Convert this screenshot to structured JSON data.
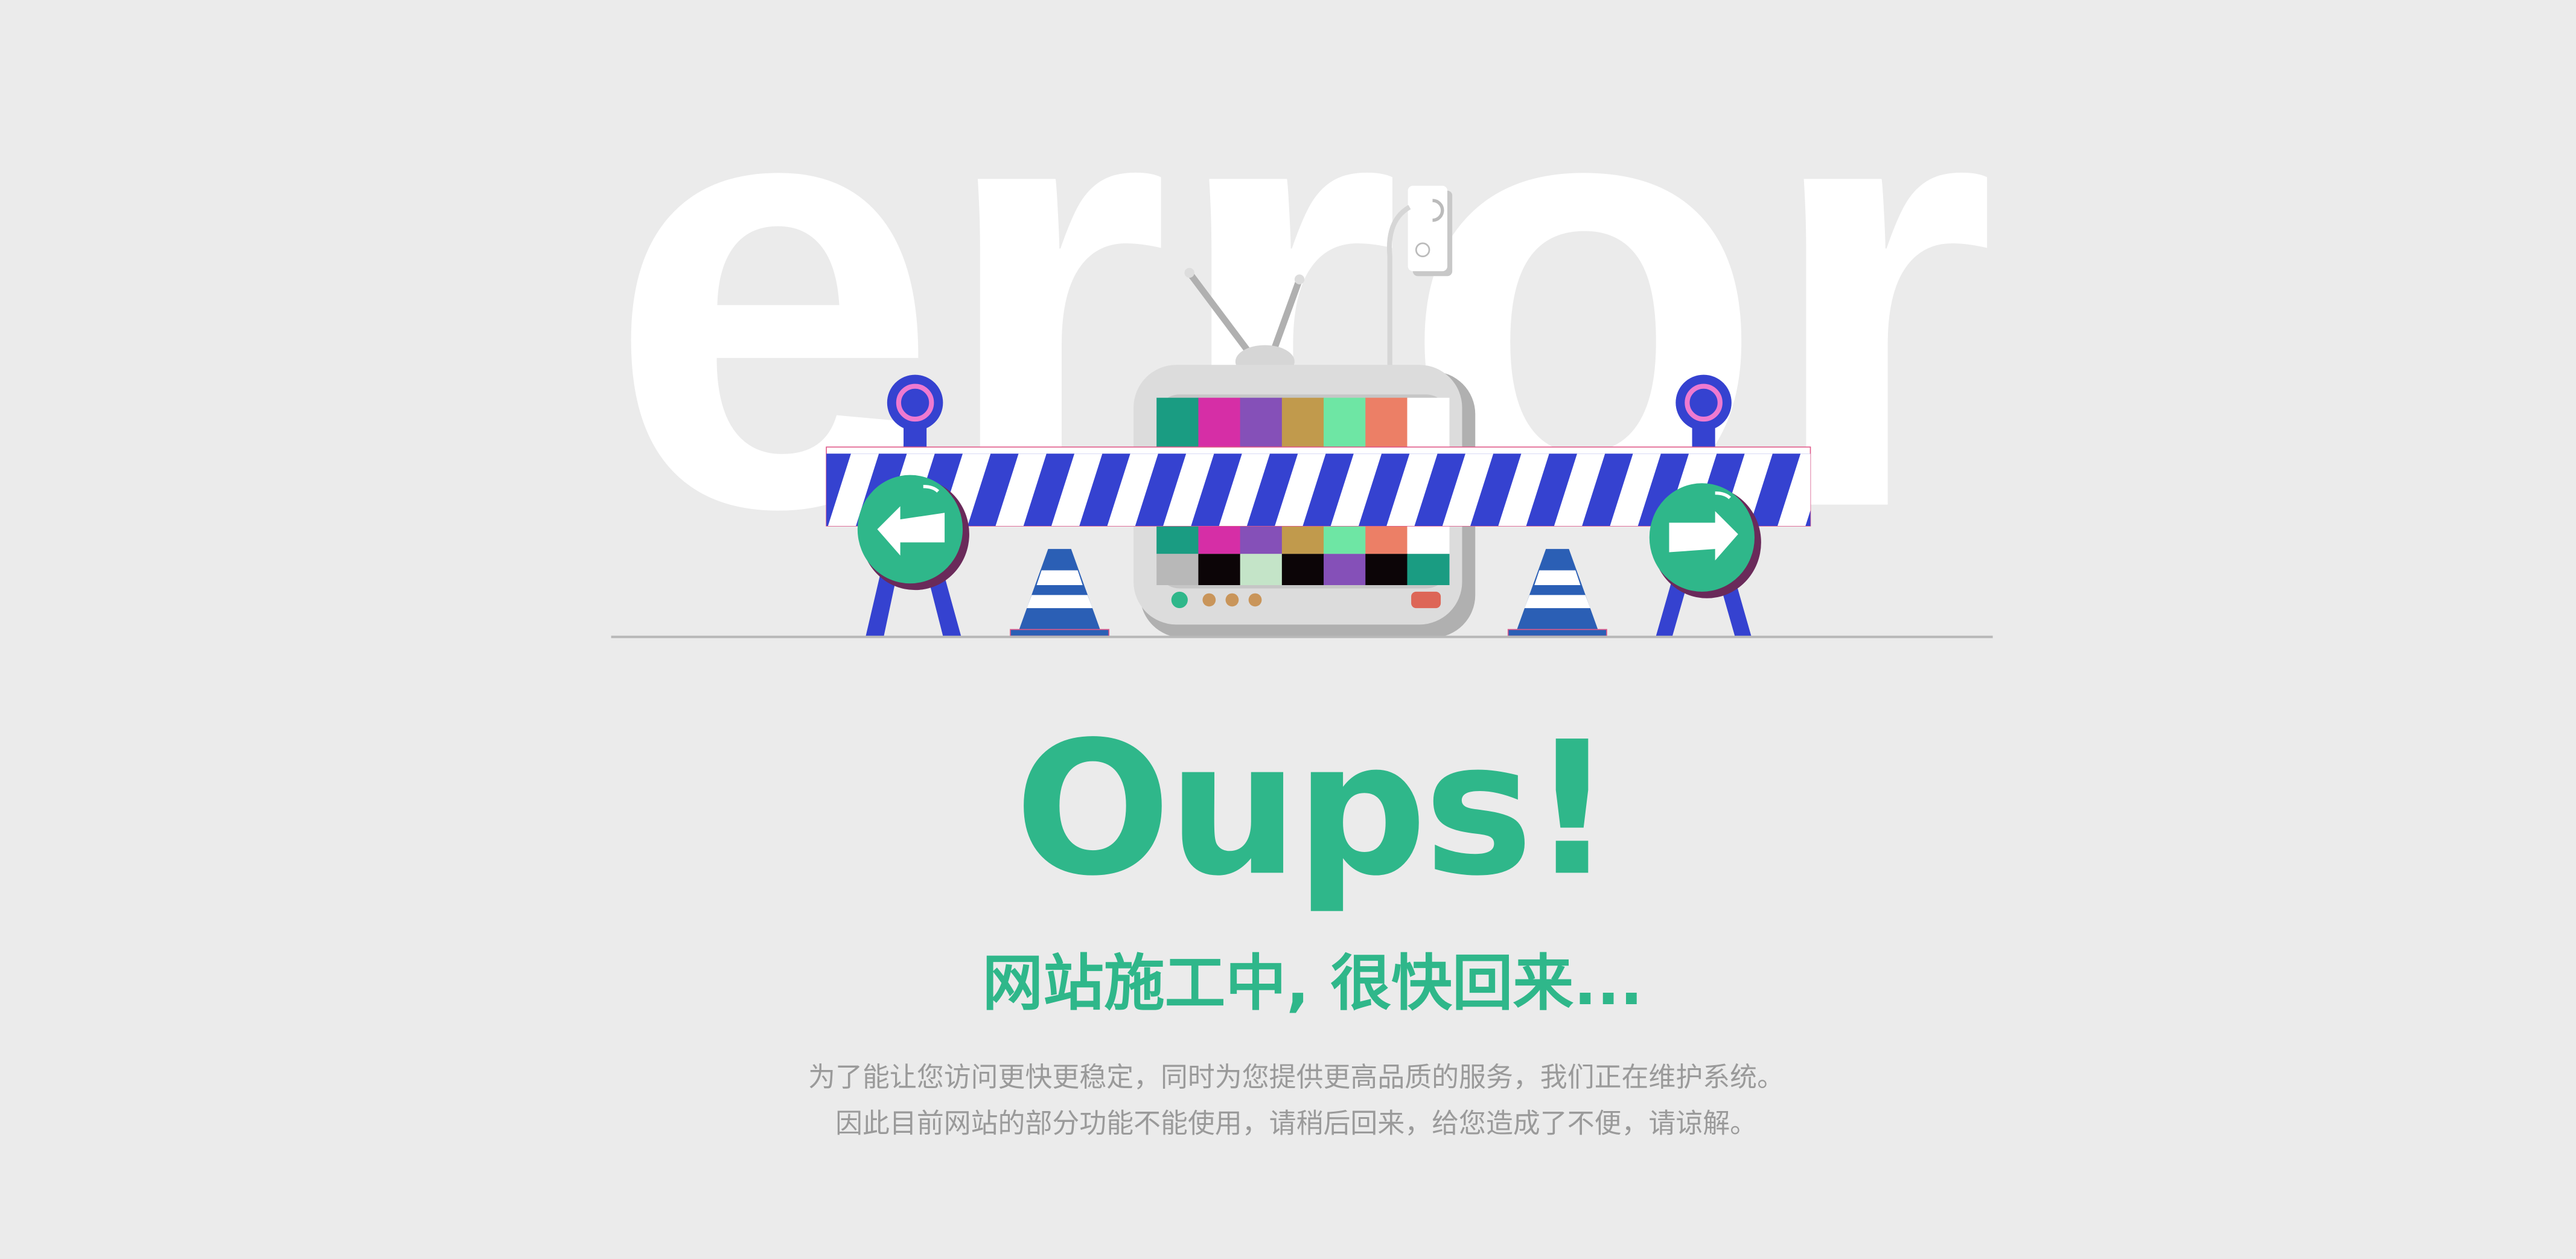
{
  "background_word": "error",
  "heading": "Oups!",
  "subheading": "网站施工中, 很快回来...",
  "message_lines": [
    "为了能让您访问更快更稳定，同时为您提供更高品质的服务，我们正在维护系统。",
    "因此目前网站的部分功能不能使用，请稍后回来，给您造成了不便，请谅解。"
  ],
  "colors": {
    "accent_green": "#2fb78a",
    "barrier_blue": "#3542d0",
    "background": "#ebebeb",
    "text_gray": "#9a9a9a"
  },
  "tv_color_bars_top": [
    "#1a9c82",
    "#d62ea6",
    "#8550b8",
    "#c19a4c",
    "#6ee6a4",
    "#ec7f66",
    "#ffffff"
  ],
  "tv_color_bars_bottom": [
    "#b8b8b8",
    "#0c0507",
    "#c4e4c8",
    "#0c0507",
    "#8550b8",
    "#0c0507",
    "#1a9c82"
  ]
}
